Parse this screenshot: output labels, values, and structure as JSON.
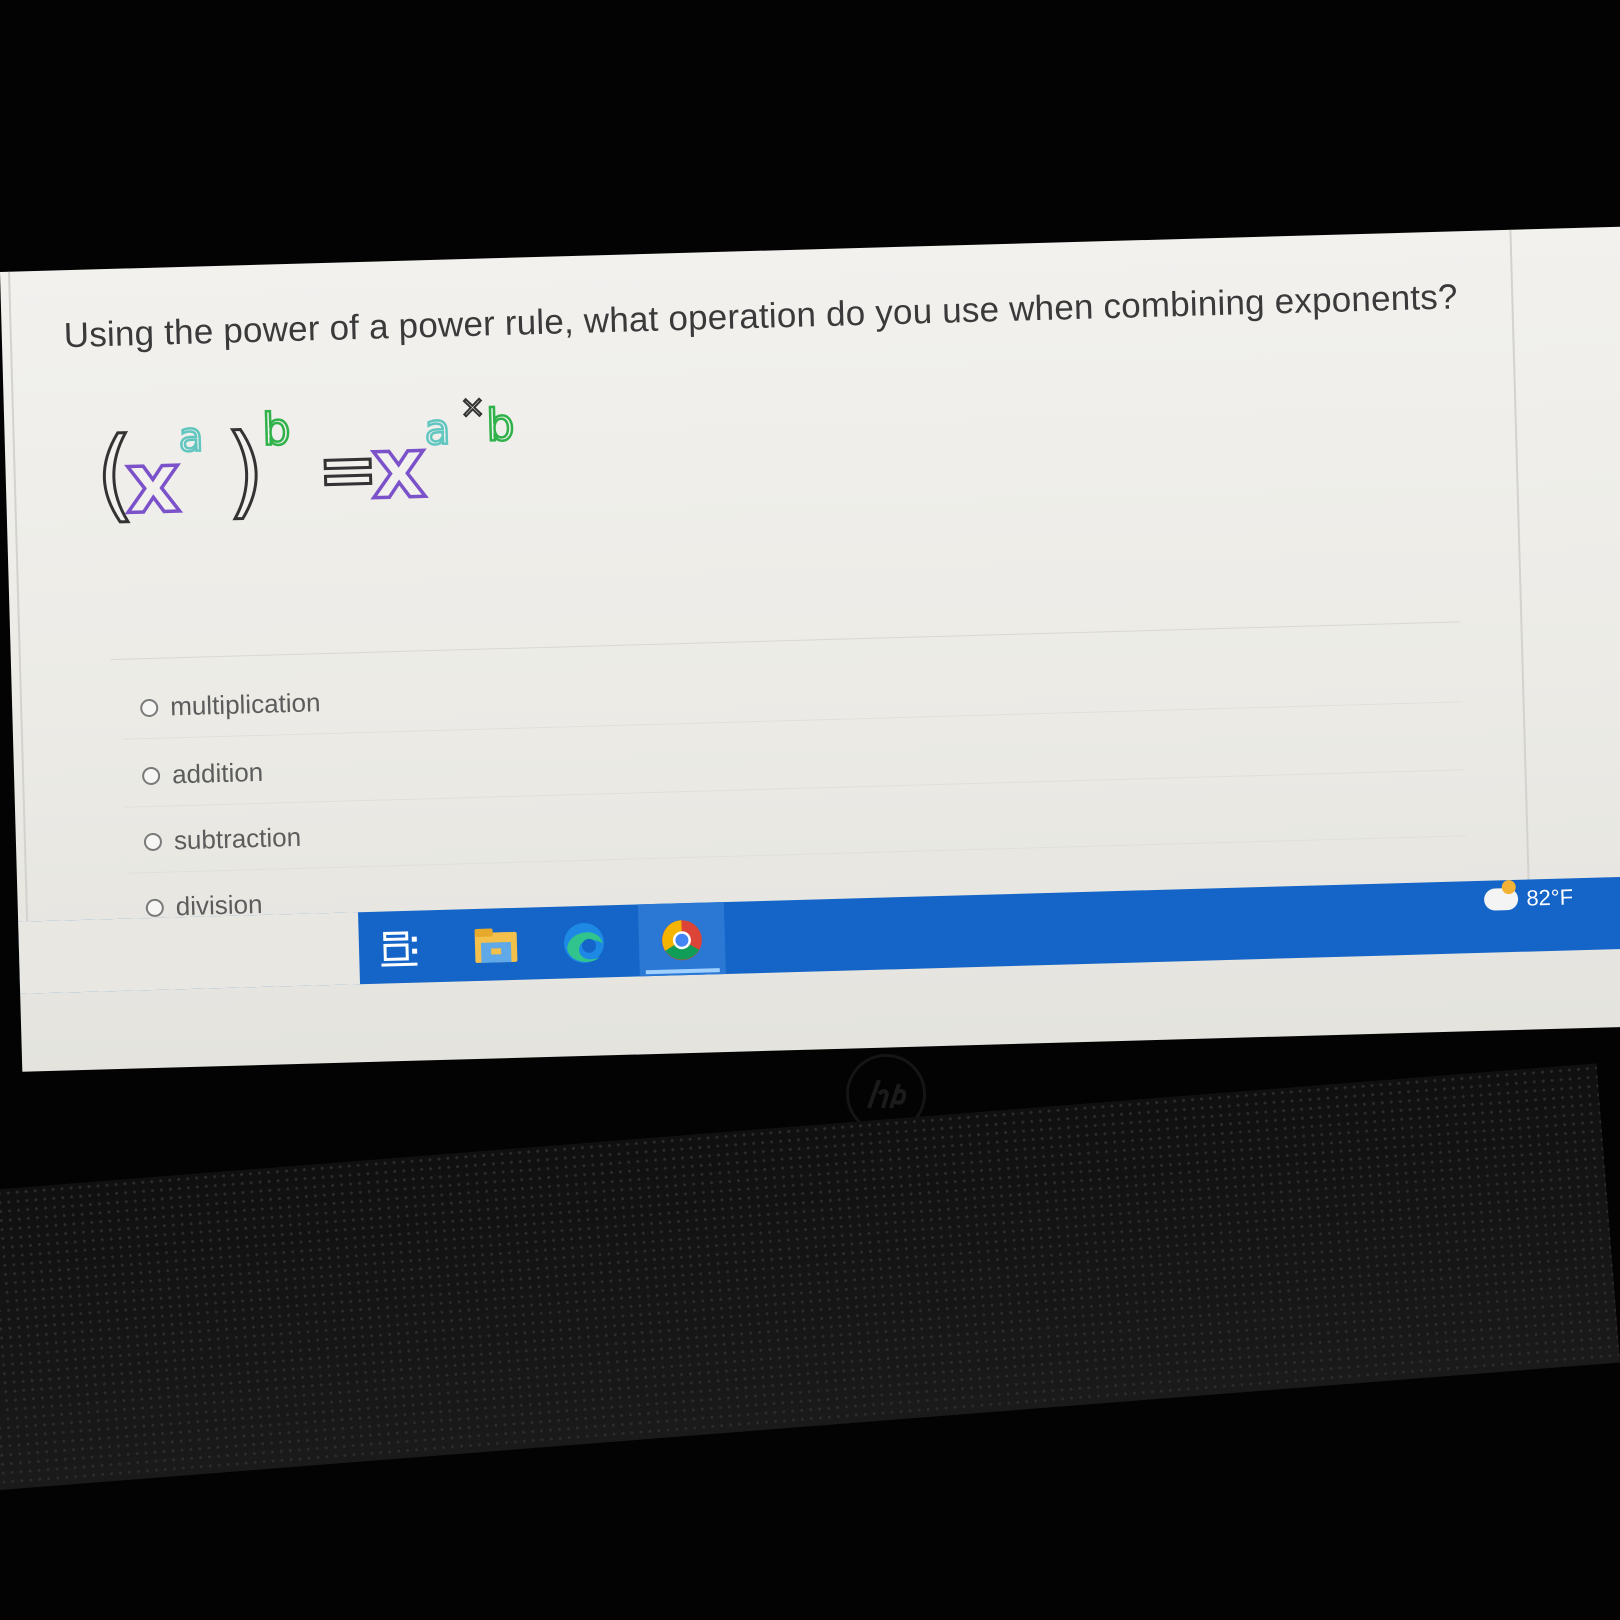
{
  "question": {
    "text": "Using the power of a power rule, what operation do you use when combining exponents?"
  },
  "formula": {
    "lhs_open": "(",
    "base": "x",
    "inner_exp": "a",
    "lhs_close": ")",
    "outer_exp": "b",
    "equals": "=",
    "rhs_base": "x",
    "rhs_exp_a": "a",
    "rhs_op": "×",
    "rhs_exp_b": "b"
  },
  "options": [
    {
      "label": "multiplication",
      "selected": false
    },
    {
      "label": "addition",
      "selected": false
    },
    {
      "label": "subtraction",
      "selected": false
    },
    {
      "label": "division",
      "selected": false
    }
  ],
  "taskbar": {
    "apps": [
      "task-view-icon",
      "file-explorer-icon",
      "edge-icon",
      "chrome-icon"
    ],
    "weather": {
      "temperature": "82°F",
      "icon": "partly-cloudy-icon"
    },
    "color": "#1565c8"
  },
  "bezel": {
    "brand_icon": "hp-logo"
  },
  "colors": {
    "formula_outline_dark": "#333333",
    "formula_purple": "#7b52c9",
    "formula_teal": "#62c6c0",
    "formula_green": "#2fb24a"
  }
}
